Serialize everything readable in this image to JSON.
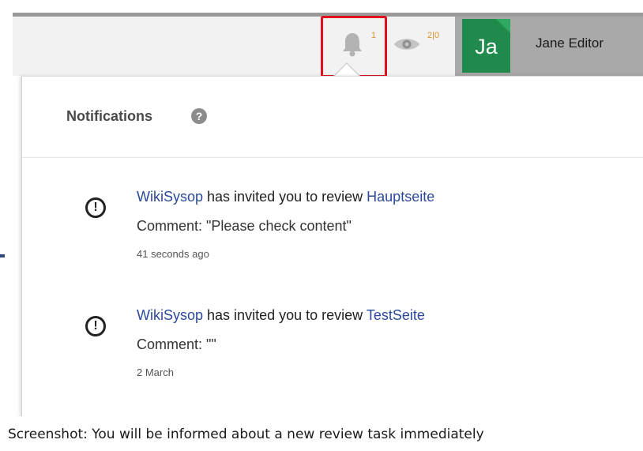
{
  "header": {
    "bell": {
      "icon": "bell-icon",
      "count": "1"
    },
    "watch": {
      "icon": "eye-icon",
      "count": "2|0"
    },
    "user": {
      "initials": "Ja",
      "name": "Jane Editor"
    }
  },
  "notifications": {
    "title": "Notifications",
    "help_icon": "help-icon",
    "items": [
      {
        "actor": "WikiSysop",
        "action": "has invited you to review",
        "page": "Hauptseite",
        "comment": "Comment: \"Please check content\"",
        "time": "41 seconds ago",
        "icon": "alert-circle-icon"
      },
      {
        "actor": "WikiSysop",
        "action": "has invited you to review",
        "page": "TestSeite",
        "comment": "Comment: \"\"",
        "time": "2 March",
        "icon": "alert-circle-icon"
      }
    ]
  },
  "caption": "Screenshot: You will be informed about a new review task immediately",
  "colors": {
    "link": "#2b4a9a",
    "badge": "#d9952b",
    "highlight": "#e0101e",
    "avatar": "#1f8a4c"
  }
}
